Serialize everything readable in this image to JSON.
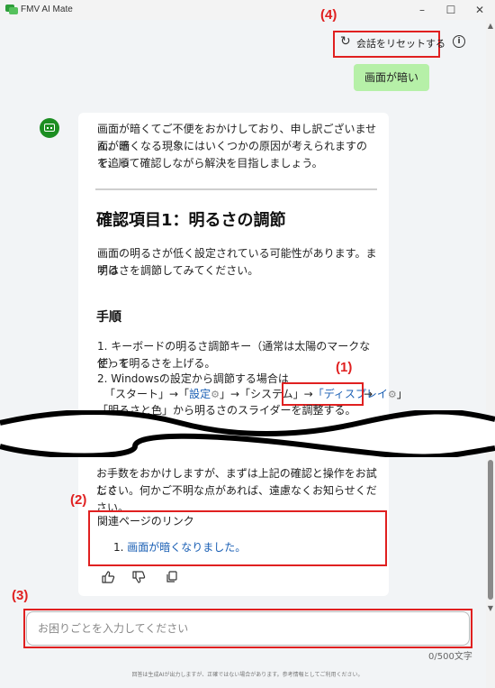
{
  "window": {
    "title": "FMV AI Mate",
    "controls": {
      "minimize": "–",
      "maximize": "☐",
      "close": "✕"
    }
  },
  "callouts": {
    "one": "(1)",
    "two": "(2)",
    "three": "(3)",
    "four": "(4)"
  },
  "header": {
    "reset_label": "会話をリセットする",
    "reset_icon": "refresh-icon",
    "info_icon": "info-icon",
    "info_glyph": "i"
  },
  "user_message": "画面が暗い",
  "assistant": {
    "intro_line1": "画面が暗くてご不便をおかけしており、申し訳ございません。画",
    "intro_line2": "面が暗くなる現象にはいくつかの原因が考えられますので、順",
    "intro_line3": "を追って確認しながら解決を目指しましょう。",
    "section_title": "確認項目1：明るさの調節",
    "section_line1": "画面の明るさが低く設定されている可能性があります。まずは",
    "section_line2": "明るさを調節してみてください。",
    "steps_title": "手順",
    "step1_line1": "1. キーボードの明るさ調節キー（通常は太陽のマークなど）を",
    "step1_line2": "使って明るさを上げる。",
    "step2_line1": "2. Windowsの設定から調節する場合は",
    "step2_start": "「スタート」→「",
    "step2_settings_link": "設定",
    "step2_mid": "」→「システム」→",
    "step2_display_link": "「ディスプレイ",
    "step2_after_display": "」",
    "step2_arrow": "→",
    "step2_line3": "「明るさと色」から明るさのスライダーを調整する。",
    "gear_glyph": "⚙",
    "closing_line1": "お手数をおかけしますが、まずは上記の確認と操作をお試しく",
    "closing_line2": "ださい。何かご不明な点があれば、遠慮なくお知らせください。",
    "related_title": "関連ページのリンク",
    "related_link_number": "1.",
    "related_link": "画面が暗くなりました。"
  },
  "feedback": {
    "thumbs_up": "👍",
    "thumbs_down": "👎",
    "copy": "copy-icon"
  },
  "input": {
    "placeholder": "お困りごとを入力してください",
    "counter": "0/500文字"
  },
  "footer_note": "回答は生成AIが出力しますが、正確ではない場合があります。参考情報としてご利用ください。",
  "colors": {
    "accent_green": "#1c8e22",
    "user_bubble": "#b6f0a8",
    "callout_red": "#e02020",
    "link_blue": "#1a5fb4"
  }
}
